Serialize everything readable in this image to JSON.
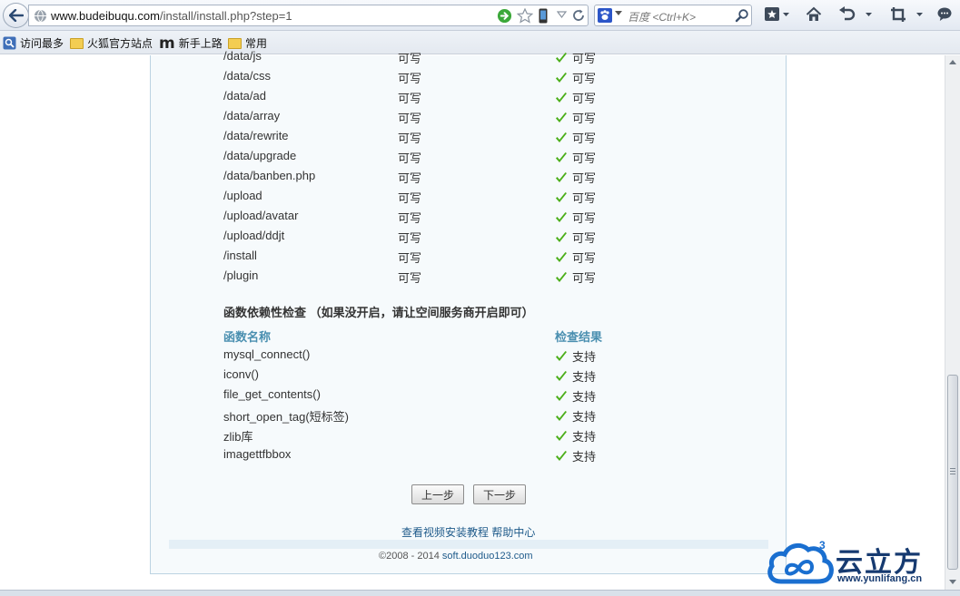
{
  "browser": {
    "url_host": "www.budeibuqu.com",
    "url_path": "/install/install.php?step=1",
    "search_placeholder": "百度 <Ctrl+K>"
  },
  "bookmarks": [
    {
      "label": "访问最多"
    },
    {
      "label": "火狐官方站点"
    },
    {
      "label": "新手上路"
    },
    {
      "label": "常用"
    }
  ],
  "dir_rows": [
    {
      "path": "/data/js",
      "required": "可写",
      "status": "可写"
    },
    {
      "path": "/data/css",
      "required": "可写",
      "status": "可写"
    },
    {
      "path": "/data/ad",
      "required": "可写",
      "status": "可写"
    },
    {
      "path": "/data/array",
      "required": "可写",
      "status": "可写"
    },
    {
      "path": "/data/rewrite",
      "required": "可写",
      "status": "可写"
    },
    {
      "path": "/data/upgrade",
      "required": "可写",
      "status": "可写"
    },
    {
      "path": "/data/banben.php",
      "required": "可写",
      "status": "可写"
    },
    {
      "path": "/upload",
      "required": "可写",
      "status": "可写"
    },
    {
      "path": "/upload/avatar",
      "required": "可写",
      "status": "可写"
    },
    {
      "path": "/upload/ddjt",
      "required": "可写",
      "status": "可写"
    },
    {
      "path": "/install",
      "required": "可写",
      "status": "可写"
    },
    {
      "path": "/plugin",
      "required": "可写",
      "status": "可写"
    }
  ],
  "func_section": {
    "title": "函数依赖性检查 （如果没开启，请让空间服务商开启即可）",
    "col_name": "函数名称",
    "col_result": "检查结果",
    "rows": [
      {
        "name": "mysql_connect()",
        "result": "支持"
      },
      {
        "name": "iconv()",
        "result": "支持"
      },
      {
        "name": "file_get_contents()",
        "result": "支持"
      },
      {
        "name": "short_open_tag(短标签)",
        "result": "支持"
      },
      {
        "name": "zlib库",
        "result": "支持"
      },
      {
        "name": "imagettfbbox",
        "result": "支持"
      }
    ]
  },
  "buttons": {
    "prev": "上一步",
    "next": "下一步"
  },
  "help_link": "查看视频安装教程 帮助中心",
  "footer": {
    "copyright": "©2008 - 2014",
    "site": "soft.duoduo123.com"
  },
  "watermark": {
    "name": "云立方",
    "url": "www.yunlifang.cn",
    "superscript": "3"
  },
  "colors": {
    "check_green": "#4caf1a",
    "header_teal": "#4a8fb0",
    "link_blue": "#1e5a8a"
  }
}
